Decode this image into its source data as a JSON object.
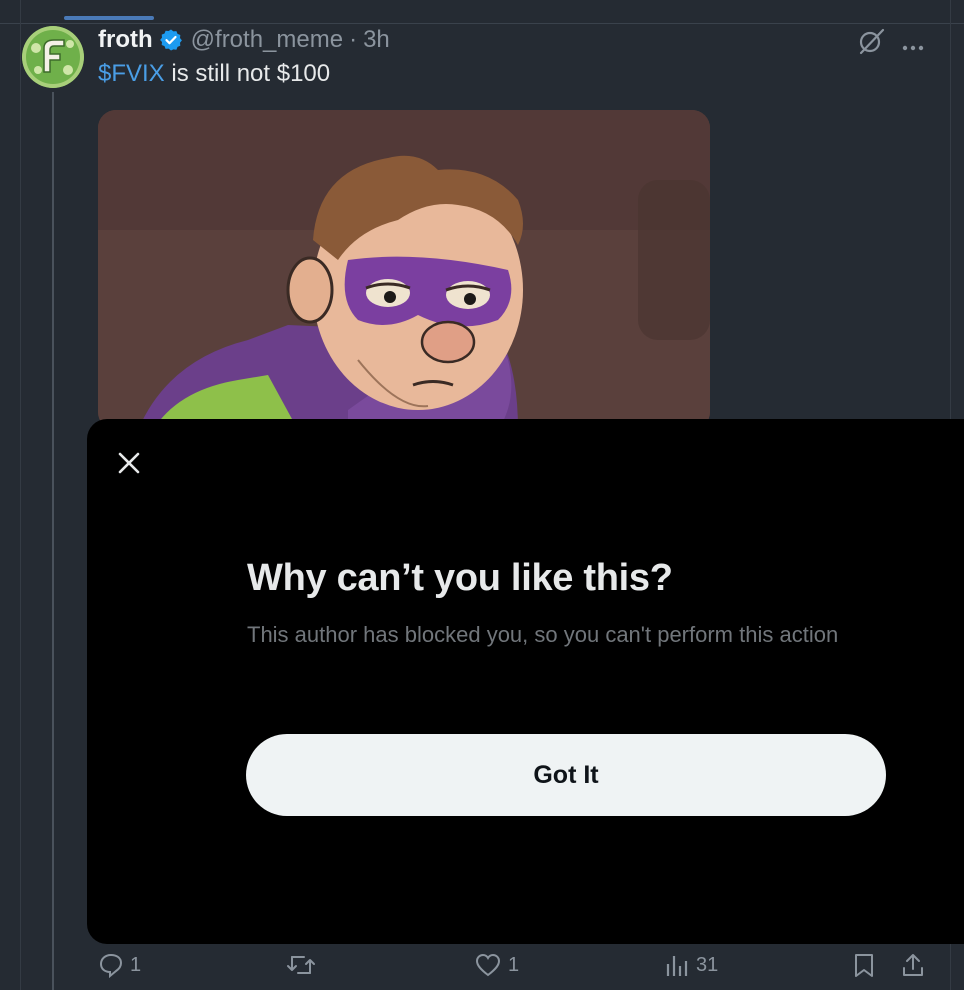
{
  "tweet": {
    "author_name": "froth",
    "handle": "@froth_meme",
    "separator": "·",
    "time": "3h",
    "text_cashtag": "$FVIX",
    "text_rest": " is still not $100"
  },
  "actions": {
    "reply_count": "1",
    "like_count": "1",
    "views_count": "31"
  },
  "modal": {
    "title": "Why can’t you like this?",
    "description": "This author has blocked you, so you can't perform this action",
    "button_label": "Got It"
  },
  "colors": {
    "background": "#252b33",
    "link": "#4a9ee6",
    "verified": "#1d9bf0",
    "modal_bg": "#000000",
    "button_bg": "#eff3f4"
  },
  "icons": [
    "grok-icon",
    "more-icon",
    "close-icon",
    "reply-icon",
    "retweet-icon",
    "like-icon",
    "views-icon",
    "bookmark-icon",
    "share-icon",
    "verified-badge-icon"
  ]
}
